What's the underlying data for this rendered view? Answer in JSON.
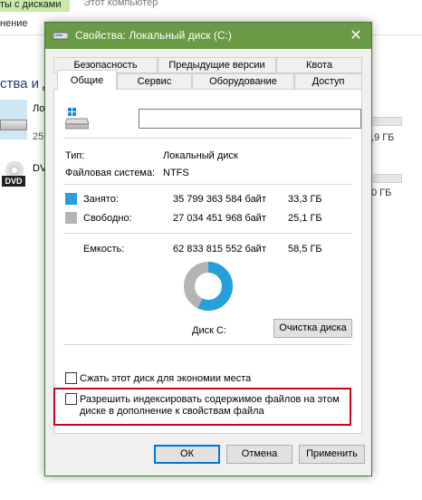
{
  "background": {
    "tab_label": "ты с дисками",
    "window_title": "Этот компьютер",
    "ribbon_item": "нение",
    "section_label": "ства и д",
    "drive1_label": "Ло",
    "drive1_sub": "25",
    "drive2_label": "DV",
    "drive1_free": ",9 ГБ",
    "drive2_free": "0 ГБ",
    "dvd_badge": "DVD"
  },
  "dialog": {
    "title": "Свойства: Локальный диск (C:)",
    "tabs_row1": [
      "Безопасность",
      "Предыдущие версии",
      "Квота"
    ],
    "tabs_row2": [
      "Общие",
      "Сервис",
      "Оборудование",
      "Доступ"
    ],
    "active_tab": "Общие",
    "volume_name": {
      "value": "",
      "placeholder": ""
    },
    "type_label": "Тип:",
    "type_value": "Локальный диск",
    "fs_label": "Файловая система:",
    "fs_value": "NTFS",
    "used": {
      "label": "Занято:",
      "bytes": "35 799 363 584 байт",
      "gb": "33,3 ГБ",
      "color": "#26a0da"
    },
    "free": {
      "label": "Свободно:",
      "bytes": "27 034 451 968 байт",
      "gb": "25,1 ГБ",
      "color": "#b4b4b4"
    },
    "capacity": {
      "label": "Емкость:",
      "bytes": "62 833 815 552 байт",
      "gb": "58,5 ГБ"
    },
    "used_fraction": 0.57,
    "drive_caption": "Диск C:",
    "cleanup_button": "Очистка диска",
    "compress_label": "Сжать этот диск для экономии места",
    "compress_checked": false,
    "index_label_line1": "Разрешить индексировать содержимое файлов на этом",
    "index_label_line2": "диске в дополнение к свойствам файла",
    "index_checked": false,
    "ok_button": "ОК",
    "cancel_button": "Отмена",
    "apply_button": "Применить",
    "accent_color": "#6a9a45",
    "highlight_color": "#d0021b"
  }
}
